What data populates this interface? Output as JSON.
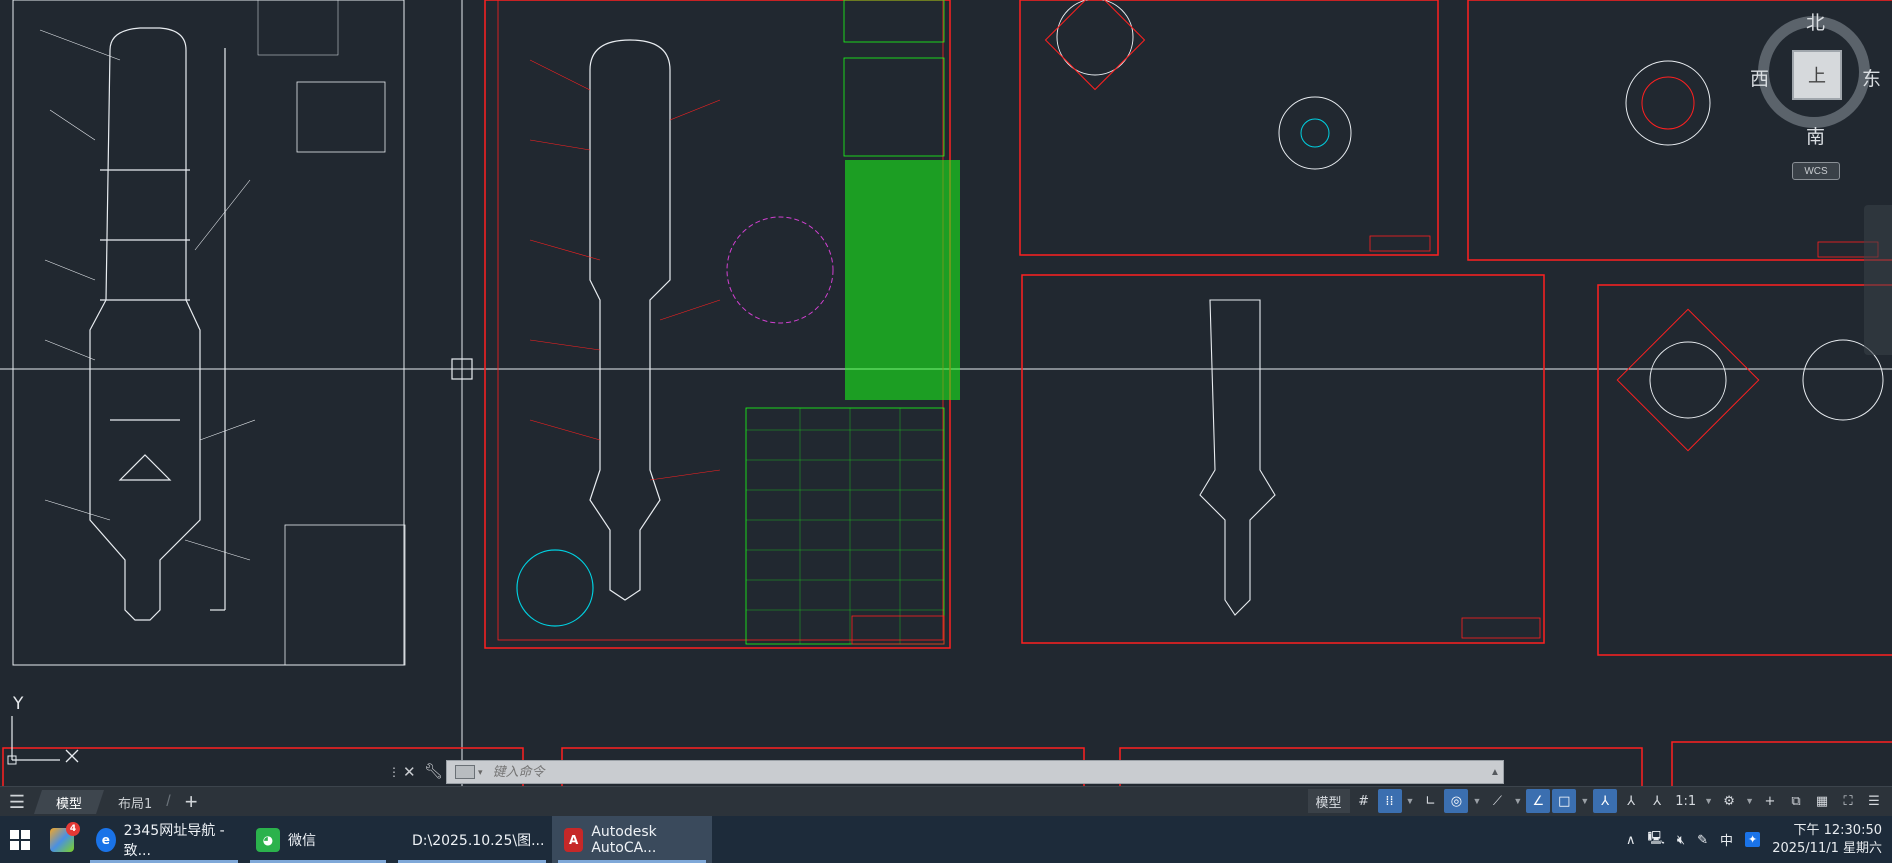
{
  "app": {
    "title": "Autodesk AutoCAD"
  },
  "viewcube": {
    "north": "北",
    "south": "南",
    "east": "东",
    "west": "西",
    "face": "上",
    "wcs": "WCS"
  },
  "ucs": {
    "y_label": "Y"
  },
  "command_line": {
    "placeholder": "键入命令"
  },
  "layout_tabs": {
    "model": "模型",
    "layout1": "布局1",
    "add": "+"
  },
  "status_bar": {
    "model": "模型",
    "scale": "1:1"
  },
  "taskbar": {
    "apps": [
      {
        "label": "2345网址导航 - 致...",
        "color": "#1a73e8",
        "glyph": "e"
      },
      {
        "label": "微信",
        "color": "#2bb24c",
        "glyph": "W"
      },
      {
        "label": "D:\\2025.10.25\\图...",
        "color": "#e8b73a",
        "glyph": ""
      },
      {
        "label": "Autodesk AutoCA...",
        "color": "#c62828",
        "glyph": "A"
      }
    ],
    "pinned_badge": "4",
    "ime": "中",
    "time": "下午 12:30:50",
    "date": "2025/11/1 星期六"
  },
  "colors": {
    "canvas": "#212830",
    "border": "#ff2020",
    "white_line": "#e8ecf0",
    "green": "#19ff19"
  }
}
